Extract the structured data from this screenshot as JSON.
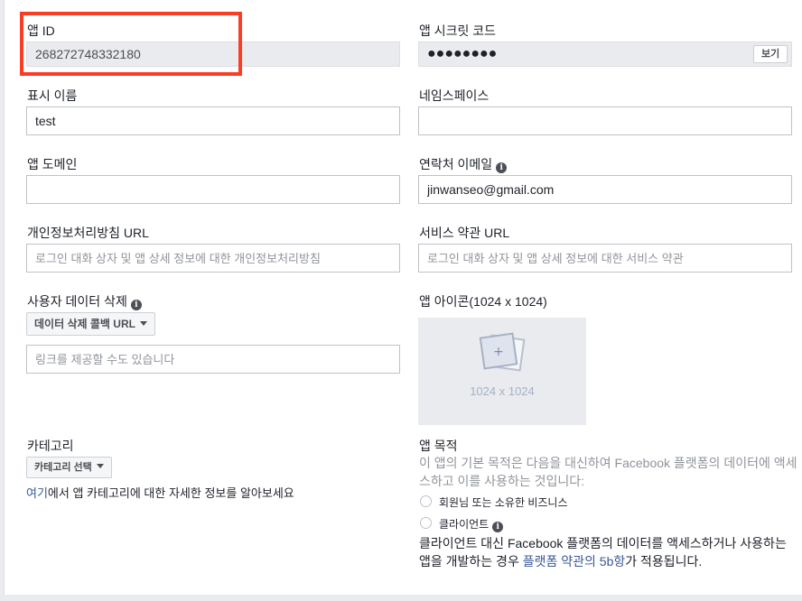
{
  "app_id": {
    "label": "앱 ID",
    "value": "268272748332180"
  },
  "app_secret": {
    "label": "앱 시크릿 코드",
    "value": "●●●●●●●●",
    "show_label": "보기"
  },
  "display_name": {
    "label": "표시 이름",
    "value": "test"
  },
  "namespace": {
    "label": "네임스페이스",
    "value": ""
  },
  "app_domain": {
    "label": "앱 도메인",
    "value": ""
  },
  "contact_email": {
    "label": "연락처 이메일",
    "value": "jinwanseo@gmail.com"
  },
  "privacy_url": {
    "label": "개인정보처리방침 URL",
    "placeholder": "로그인 대화 상자 및 앱 상세 정보에 대한 개인정보처리방침"
  },
  "terms_url": {
    "label": "서비스 약관 URL",
    "placeholder": "로그인 대화 상자 및 앱 상세 정보에 대한 서비스 약관"
  },
  "data_deletion": {
    "label": "사용자 데이터 삭제",
    "dropdown_label": "데이터 삭제 콜백 URL",
    "placeholder": "링크를 제공할 수도 있습니다"
  },
  "app_icon": {
    "label": "앱 아이콘(1024 x 1024)",
    "size_text": "1024 x 1024"
  },
  "category": {
    "label": "카테고리",
    "dropdown_label": "카테고리 선택",
    "help_link": "여기",
    "help_text": "에서 앱 카테고리에 대한 자세한 정보를 알아보세요"
  },
  "app_purpose": {
    "label": "앱 목적",
    "description": "이 앱의 기본 목적은 다음을 대신하여 Facebook 플랫폼의 데이터에 액세스하고 이를 사용하는 것입니다:",
    "option_1": "회원님 또는 소유한 비즈니스",
    "option_2": "클라이언트",
    "note_prefix": "클라이언트 대신 Facebook 플랫폼의 데이터를 액세스하거나 사용하는 앱을 개발하는 경우 ",
    "note_link": "플랫폼 약관의 5b항",
    "note_suffix": "가 적용됩니다."
  },
  "colors": {
    "highlight": "#fa3e25",
    "link": "#385898",
    "border": "#bec3c9"
  }
}
